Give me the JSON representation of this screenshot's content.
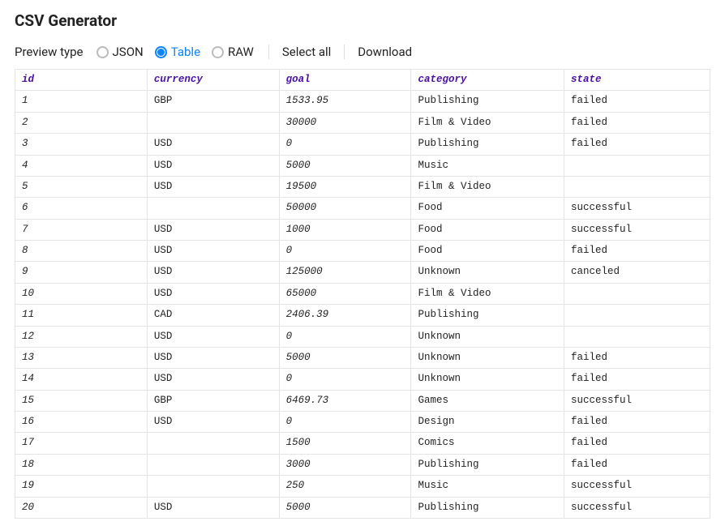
{
  "title": "CSV Generator",
  "toolbar": {
    "preview_label": "Preview type",
    "options": {
      "json": "JSON",
      "table": "Table",
      "raw": "RAW"
    },
    "selected": "table",
    "select_all": "Select all",
    "download": "Download"
  },
  "table": {
    "columns": [
      "id",
      "currency",
      "goal",
      "category",
      "state"
    ],
    "rows": [
      {
        "id": "1",
        "currency": "GBP",
        "goal": "1533.95",
        "category": "Publishing",
        "state": "failed"
      },
      {
        "id": "2",
        "currency": "",
        "goal": "30000",
        "category": "Film & Video",
        "state": "failed"
      },
      {
        "id": "3",
        "currency": "USD",
        "goal": "0",
        "category": "Publishing",
        "state": "failed"
      },
      {
        "id": "4",
        "currency": "USD",
        "goal": "5000",
        "category": "Music",
        "state": ""
      },
      {
        "id": "5",
        "currency": "USD",
        "goal": "19500",
        "category": "Film & Video",
        "state": ""
      },
      {
        "id": "6",
        "currency": "",
        "goal": "50000",
        "category": "Food",
        "state": "successful"
      },
      {
        "id": "7",
        "currency": "USD",
        "goal": "1000",
        "category": "Food",
        "state": "successful"
      },
      {
        "id": "8",
        "currency": "USD",
        "goal": "0",
        "category": "Food",
        "state": "failed"
      },
      {
        "id": "9",
        "currency": "USD",
        "goal": "125000",
        "category": "Unknown",
        "state": "canceled"
      },
      {
        "id": "10",
        "currency": "USD",
        "goal": "65000",
        "category": "Film & Video",
        "state": ""
      },
      {
        "id": "11",
        "currency": "CAD",
        "goal": "2406.39",
        "category": "Publishing",
        "state": ""
      },
      {
        "id": "12",
        "currency": "USD",
        "goal": "0",
        "category": "Unknown",
        "state": ""
      },
      {
        "id": "13",
        "currency": "USD",
        "goal": "5000",
        "category": "Unknown",
        "state": "failed"
      },
      {
        "id": "14",
        "currency": "USD",
        "goal": "0",
        "category": "Unknown",
        "state": "failed"
      },
      {
        "id": "15",
        "currency": "GBP",
        "goal": "6469.73",
        "category": "Games",
        "state": "successful"
      },
      {
        "id": "16",
        "currency": "USD",
        "goal": "0",
        "category": "Design",
        "state": "failed"
      },
      {
        "id": "17",
        "currency": "",
        "goal": "1500",
        "category": "Comics",
        "state": "failed"
      },
      {
        "id": "18",
        "currency": "",
        "goal": "3000",
        "category": "Publishing",
        "state": "failed"
      },
      {
        "id": "19",
        "currency": "",
        "goal": "250",
        "category": "Music",
        "state": "successful"
      },
      {
        "id": "20",
        "currency": "USD",
        "goal": "5000",
        "category": "Publishing",
        "state": "successful"
      }
    ]
  }
}
